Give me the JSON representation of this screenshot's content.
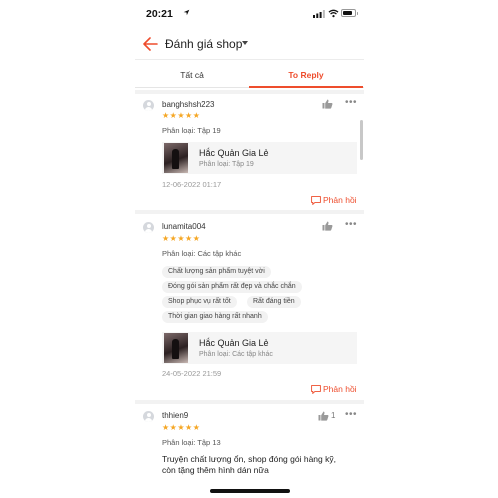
{
  "status_bar": {
    "time": "20:21"
  },
  "header": {
    "title": "Đánh giá shop"
  },
  "tabs": [
    {
      "label": "Tất cả",
      "active": false
    },
    {
      "label": "To Reply",
      "active": true
    }
  ],
  "reviews": [
    {
      "username": "banghshsh223",
      "stars": "★★★★★",
      "rating": 5,
      "variant": "Phân loại: Tập 19",
      "product_title": "Hắc Quản Gia Lẻ",
      "product_variant": "Phân loại: Tập 19",
      "date": "12-06-2022 01:17",
      "reply_label": "Phản hồi"
    },
    {
      "username": "lunamita004",
      "stars": "★★★★★",
      "rating": 5,
      "variant": "Phân loại: Các tập khác",
      "tags": [
        "Chất lượng sản phẩm tuyệt vời",
        "Đóng gói sản phẩm rất đẹp và chắc chắn",
        "Shop phục vụ rất tốt",
        "Rất đáng tiền",
        "Thời gian giao hàng rất nhanh"
      ],
      "product_title": "Hắc Quản Gia Lẻ",
      "product_variant": "Phân loại: Các tập khác",
      "date": "24-05-2022 21:59",
      "reply_label": "Phản hồi"
    },
    {
      "username": "thhien9",
      "stars": "★★★★★",
      "rating": 5,
      "variant": "Phân loại: Tập 13",
      "like_count": "1",
      "text_line1": "Truyện chất lượng ổn, shop đóng gói hàng kỹ,",
      "text_line2": "còn tặng thêm hình dán nữa"
    }
  ],
  "colors": {
    "accent": "#ee4d2d",
    "star": "#f5a623"
  },
  "icons": [
    "back-arrow-icon",
    "caret-down-icon",
    "thumbs-up-icon",
    "more-icon",
    "reply-icon",
    "avatar"
  ]
}
